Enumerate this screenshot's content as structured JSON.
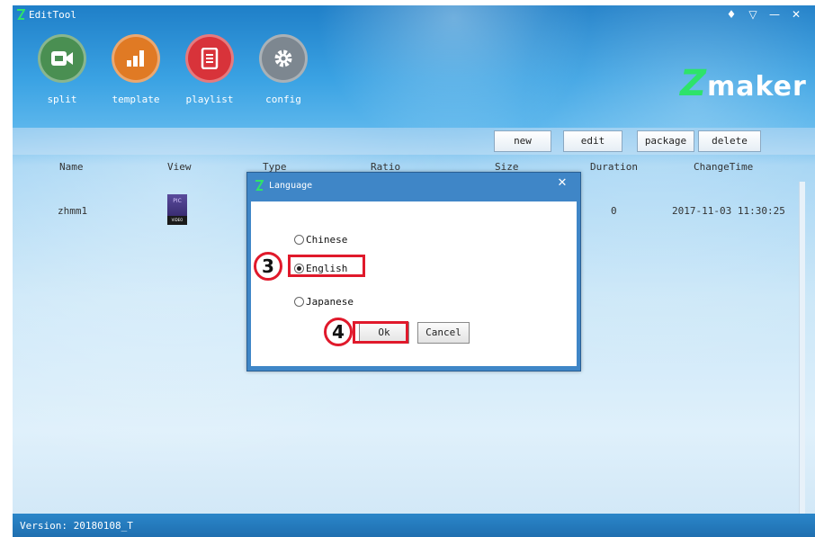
{
  "window": {
    "title": "EditTool",
    "controls": [
      "♦",
      "▽",
      "—",
      "✕"
    ]
  },
  "nav": [
    {
      "label": "split",
      "icon": "video-camera-icon",
      "color": "#4a8f52"
    },
    {
      "label": "template",
      "icon": "bar-chart-icon",
      "color": "#e07a24"
    },
    {
      "label": "playlist",
      "icon": "document-list-icon",
      "color": "#d8333a"
    },
    {
      "label": "config",
      "icon": "gear-icon",
      "color": "#7d8790"
    }
  ],
  "brand": {
    "z": "Z",
    "rest": "maker",
    "accent": "#2ee36a"
  },
  "toolbar": {
    "buttons": [
      "new",
      "edit",
      "package",
      "delete"
    ]
  },
  "table": {
    "columns": [
      "Name",
      "View",
      "Type",
      "Ratio",
      "Size",
      "Duration",
      "ChangeTime"
    ],
    "rows": [
      {
        "name": "zhmm1",
        "thumb_top": "PIC",
        "thumb_bottom": "VIDEO",
        "duration": "0",
        "changetime": "2017-11-03 11:30:25"
      }
    ]
  },
  "status": {
    "version": "Version: 20180108_T"
  },
  "dialog": {
    "title": "Language",
    "close": "✕",
    "options": [
      {
        "label": "Chinese",
        "selected": false
      },
      {
        "label": "English",
        "selected": true
      },
      {
        "label": "Japanese",
        "selected": false
      }
    ],
    "ok_label": "Ok",
    "cancel_label": "Cancel"
  },
  "annotations": {
    "step_english": "3",
    "step_ok": "4",
    "color": "#e0192b"
  }
}
